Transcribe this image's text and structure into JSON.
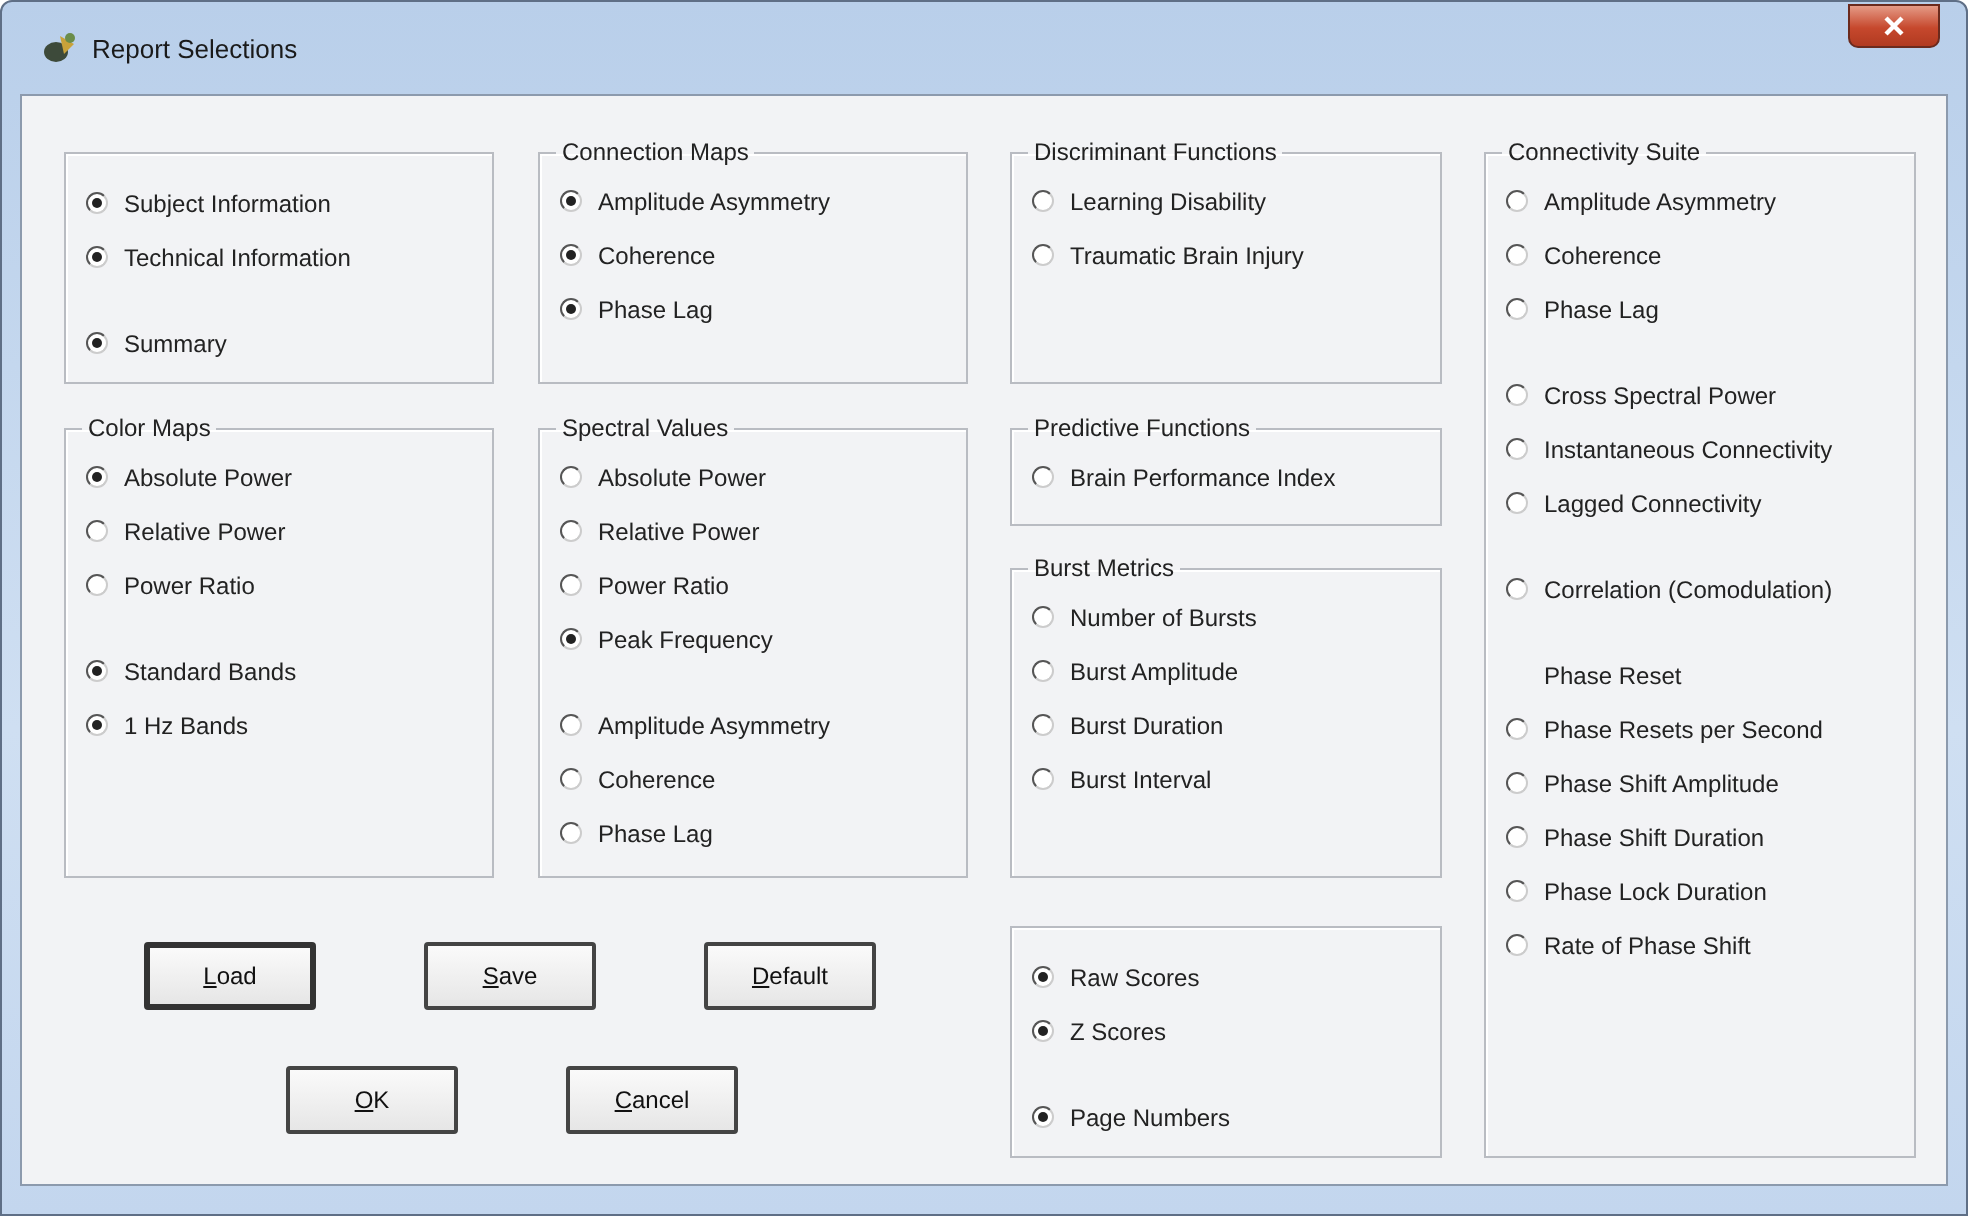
{
  "window": {
    "title": "Report Selections"
  },
  "columns": [
    {
      "groups": [
        {
          "sections": [
            [
              {
                "kind": "radio",
                "label": "Subject Information",
                "selected": true
              },
              {
                "kind": "radio",
                "label": "Technical Information",
                "selected": true
              }
            ],
            [
              {
                "kind": "radio",
                "label": "Summary",
                "selected": true
              }
            ]
          ]
        },
        {
          "title": "Color Maps",
          "sections": [
            [
              {
                "kind": "radio",
                "label": "Absolute Power",
                "selected": true
              },
              {
                "kind": "radio",
                "label": "Relative Power",
                "selected": false
              },
              {
                "kind": "radio",
                "label": "Power Ratio",
                "selected": false
              }
            ],
            [
              {
                "kind": "radio",
                "label": "Standard Bands",
                "selected": true
              },
              {
                "kind": "radio",
                "label": "1 Hz Bands",
                "selected": true
              }
            ]
          ]
        }
      ]
    },
    {
      "groups": [
        {
          "title": "Connection Maps",
          "sections": [
            [
              {
                "kind": "radio",
                "label": "Amplitude Asymmetry",
                "selected": true
              },
              {
                "kind": "radio",
                "label": "Coherence",
                "selected": true
              },
              {
                "kind": "radio",
                "label": "Phase Lag",
                "selected": true
              }
            ]
          ]
        },
        {
          "title": "Spectral Values",
          "sections": [
            [
              {
                "kind": "radio",
                "label": "Absolute Power",
                "selected": false
              },
              {
                "kind": "radio",
                "label": "Relative Power",
                "selected": false
              },
              {
                "kind": "radio",
                "label": "Power Ratio",
                "selected": false
              },
              {
                "kind": "radio",
                "label": "Peak Frequency",
                "selected": true
              }
            ],
            [
              {
                "kind": "radio",
                "label": "Amplitude Asymmetry",
                "selected": false
              },
              {
                "kind": "radio",
                "label": "Coherence",
                "selected": false
              },
              {
                "kind": "radio",
                "label": "Phase Lag",
                "selected": false
              }
            ]
          ]
        }
      ]
    },
    {
      "groups": [
        {
          "title": "Discriminant Functions",
          "sections": [
            [
              {
                "kind": "radio",
                "label": "Learning Disability",
                "selected": false
              },
              {
                "kind": "radio",
                "label": "Traumatic Brain Injury",
                "selected": false
              }
            ]
          ]
        },
        {
          "title": "Predictive Functions",
          "sections": [
            [
              {
                "kind": "radio",
                "label": "Brain Performance Index",
                "selected": false
              }
            ]
          ]
        },
        {
          "title": "Burst Metrics",
          "sections": [
            [
              {
                "kind": "radio",
                "label": "Number of Bursts",
                "selected": false
              },
              {
                "kind": "radio",
                "label": "Burst Amplitude",
                "selected": false
              },
              {
                "kind": "radio",
                "label": "Burst Duration",
                "selected": false
              },
              {
                "kind": "radio",
                "label": "Burst Interval",
                "selected": false
              }
            ]
          ]
        },
        {
          "sections": [
            [
              {
                "kind": "radio",
                "label": "Raw Scores",
                "selected": true
              },
              {
                "kind": "radio",
                "label": "Z Scores",
                "selected": true
              }
            ],
            [
              {
                "kind": "radio",
                "label": "Page Numbers",
                "selected": true
              }
            ]
          ]
        }
      ]
    },
    {
      "groups": [
        {
          "title": "Connectivity Suite",
          "sections": [
            [
              {
                "kind": "radio",
                "label": "Amplitude Asymmetry",
                "selected": false
              },
              {
                "kind": "radio",
                "label": "Coherence",
                "selected": false
              },
              {
                "kind": "radio",
                "label": "Phase Lag",
                "selected": false
              }
            ],
            [
              {
                "kind": "radio",
                "label": "Cross Spectral Power",
                "selected": false
              },
              {
                "kind": "radio",
                "label": "Instantaneous Connectivity",
                "selected": false
              },
              {
                "kind": "radio",
                "label": "Lagged Connectivity",
                "selected": false
              }
            ],
            [
              {
                "kind": "radio",
                "label": "Correlation (Comodulation)",
                "selected": false
              }
            ],
            [
              {
                "kind": "label",
                "label": "Phase Reset"
              },
              {
                "kind": "radio",
                "label": "Phase Resets per Second",
                "selected": false
              },
              {
                "kind": "radio",
                "label": "Phase Shift Amplitude",
                "selected": false
              },
              {
                "kind": "radio",
                "label": "Phase Shift Duration",
                "selected": false
              },
              {
                "kind": "radio",
                "label": "Phase Lock Duration",
                "selected": false
              },
              {
                "kind": "radio",
                "label": "Rate of Phase Shift",
                "selected": false
              }
            ]
          ]
        }
      ]
    }
  ],
  "button_rows": [
    [
      {
        "label": "Load",
        "default": true
      },
      {
        "label": "Save",
        "default": false
      },
      {
        "label": "Default",
        "default": false
      }
    ],
    [
      {
        "label": "OK",
        "default": false
      },
      {
        "label": "Cancel",
        "default": false
      }
    ]
  ]
}
